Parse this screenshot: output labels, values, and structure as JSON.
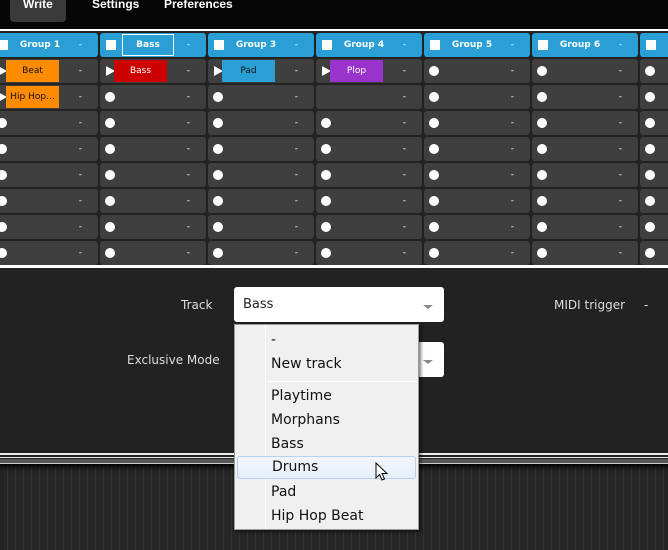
{
  "nav": {
    "items": [
      {
        "label": "Write",
        "active": true
      },
      {
        "label": "Settings",
        "active": false
      },
      {
        "label": "Preferences",
        "active": false
      }
    ]
  },
  "grid": {
    "groups": [
      {
        "name": "Group 1",
        "midi": "-",
        "selected": false,
        "check_visible": true
      },
      {
        "name": "Bass",
        "midi": "-",
        "selected": true,
        "check_visible": true
      },
      {
        "name": "Group 3",
        "midi": "-",
        "selected": false,
        "check_visible": true
      },
      {
        "name": "Group 4",
        "midi": "-",
        "selected": false,
        "check_visible": true
      },
      {
        "name": "Group 5",
        "midi": "-",
        "selected": false,
        "check_visible": true
      },
      {
        "name": "Group 6",
        "midi": "-",
        "selected": false,
        "check_visible": true
      },
      {
        "name": "",
        "midi": "",
        "selected": false,
        "check_visible": true
      }
    ],
    "rows": 8,
    "slot_midi": "-",
    "clips": [
      {
        "group": 0,
        "row": 0,
        "label": "Beat",
        "color": "#ff8c00",
        "text_color": "#111111"
      },
      {
        "group": 0,
        "row": 1,
        "label": "Hip Hop...",
        "color": "#ff8c00",
        "text_color": "#111111"
      },
      {
        "group": 1,
        "row": 0,
        "label": "Bass",
        "color": "#cc0000",
        "text_color": "#ffffff"
      },
      {
        "group": 2,
        "row": 0,
        "label": "Pad",
        "color": "#2a9fd6",
        "text_color": "#111111"
      },
      {
        "group": 3,
        "row": 0,
        "label": "Plop",
        "color": "#9933cc",
        "text_color": "#ffffff"
      }
    ],
    "play_rows": {
      "0": [
        0,
        1
      ],
      "1": [
        0
      ],
      "2": [
        0
      ],
      "3": [
        0
      ]
    },
    "empty_no_dot": [
      {
        "group": 3,
        "row": 1
      }
    ]
  },
  "form": {
    "track_label": "Track",
    "track_value": "Bass",
    "exclusive_label": "Exclusive Mode",
    "midi_trigger_label": "MIDI trigger",
    "midi_trigger_value": "-"
  },
  "dropdown": {
    "items": [
      "-",
      "New track",
      "Playtime",
      "Morphans",
      "Bass",
      "Drums",
      "Pad",
      "Hip Hop Beat"
    ],
    "hovered": "Drums"
  },
  "colors": {
    "accent": "#2a9fd6",
    "slot": "#3f3f3f",
    "background": "#222222"
  }
}
